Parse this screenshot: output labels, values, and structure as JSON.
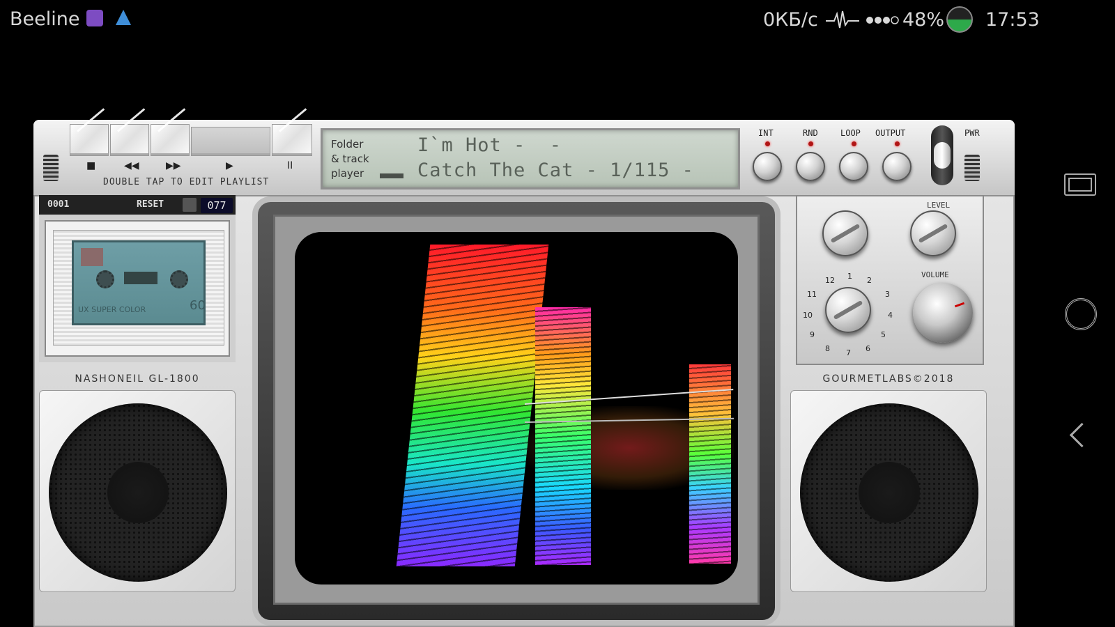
{
  "status_bar": {
    "carrier": "Beeline",
    "net_speed": "0КБ/с",
    "battery": "48%",
    "time": "17:53"
  },
  "transport": {
    "hint": "DOUBLE TAP TO EDIT PLAYLIST",
    "symbols": {
      "stop": "■",
      "rewind": "◀◀",
      "forward": "▶▶",
      "play": "▶",
      "pause": "II"
    }
  },
  "display": {
    "mode": "Folder\n& track\nplayer",
    "line1": "I`m Hot -  -",
    "line2": "Catch The Cat - 1/115 -"
  },
  "controls": {
    "int": "INT",
    "rnd": "RND",
    "loop": "LOOP",
    "output": "OUTPUT",
    "pwr": "PWR"
  },
  "deck": {
    "counter_label": "0001",
    "reset_label": "RESET",
    "counter": "077",
    "tape_brand": "UX SUPER COLOR",
    "tape_minutes": "60"
  },
  "model": "NASHONEIL GL-1800",
  "brand": "GOURMETLABS©2018",
  "panel": {
    "level": "LEVEL",
    "volume": "VOLUME",
    "dial": [
      "12",
      "1",
      "2",
      "3",
      "4",
      "5",
      "6",
      "7",
      "8",
      "9",
      "10",
      "11"
    ]
  },
  "colors": {
    "lcd_text": "#596159",
    "led": "#b01515",
    "battery_fill": "#2da94a"
  },
  "icons": {
    "status": [
      "app-icon",
      "notification-icon",
      "pulse-icon",
      "signal-icon",
      "battery-icon"
    ],
    "nav": [
      "recent-apps-icon",
      "fingerprint-icon",
      "back-icon"
    ]
  }
}
